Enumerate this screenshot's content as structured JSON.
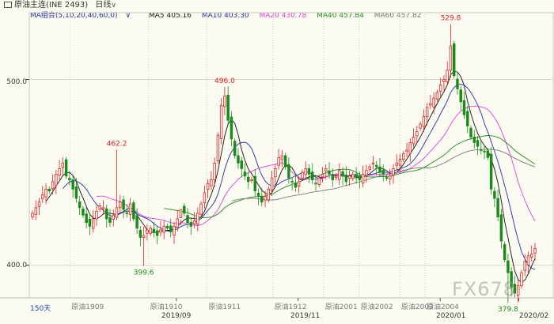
{
  "header": {
    "title": "原油主连(INE 2493)",
    "period_label": "日线"
  },
  "ma_legend": {
    "group_label": "MA组合(5,10,20,40,60,0)",
    "items": [
      {
        "label": "MA5 405.16",
        "color": "#111111"
      },
      {
        "label": "MA10 403.30",
        "color": "#1f2fa8"
      },
      {
        "label": "MA20 430.78",
        "color": "#e040e0"
      },
      {
        "label": "MA40 457.84",
        "color": "#1e8a1e"
      },
      {
        "label": "MA60 457.82",
        "color": "#777777"
      }
    ]
  },
  "axis": {
    "y_ticks": [
      "500.0",
      "400.0"
    ],
    "bar_count_label": "150天",
    "x_months": [
      "2019/09",
      "2019/11",
      "2020/01",
      "2020/02"
    ],
    "contract_markers": [
      "原油1909",
      "原油1910",
      "原油1911",
      "原油1912",
      "原油2001",
      "原油2002",
      "原油2003",
      "原油2004"
    ]
  },
  "annotations": {
    "max_label": "529.8",
    "min_label": "379.8",
    "local_high_1": "462.2",
    "local_low_1": "399.6",
    "local_high_2": "496.0"
  },
  "watermark": "FX678",
  "chart_data": {
    "type": "candlestick",
    "title": "原油主连(INE 2493)",
    "ylim": [
      382,
      530
    ],
    "y_ticks": [
      400,
      500
    ],
    "x_labels": [
      "2019/09",
      "2019/11",
      "2020/01",
      "2020/02"
    ],
    "colors": {
      "up": "#e02020",
      "down": "#1a8a1a"
    },
    "closes": [
      428,
      431,
      434,
      438,
      441,
      440,
      445,
      449,
      452,
      455,
      448,
      446,
      441,
      436,
      431,
      427,
      423,
      421,
      425,
      429,
      432,
      431,
      425,
      423,
      427,
      431,
      434,
      430,
      428,
      433,
      425,
      420,
      415,
      416,
      419,
      420,
      418,
      416,
      419,
      421,
      420,
      418,
      421,
      425,
      430,
      428,
      423,
      421,
      424,
      428,
      433,
      439,
      444,
      446,
      455,
      470,
      486,
      491,
      478,
      468,
      459,
      455,
      452,
      448,
      445,
      446,
      440,
      437,
      434,
      437,
      441,
      447,
      452,
      458,
      459,
      453,
      447,
      445,
      442,
      445,
      450,
      452,
      449,
      446,
      444,
      447,
      449,
      452,
      449,
      446,
      448,
      451,
      448,
      445,
      448,
      449,
      447,
      446,
      449,
      451,
      453,
      455,
      453,
      450,
      449,
      447,
      448,
      452,
      455,
      457,
      460,
      462,
      466,
      469,
      472,
      476,
      480,
      485,
      487,
      490,
      493,
      497,
      500,
      505,
      518,
      502,
      495,
      488,
      481,
      475,
      469,
      466,
      464,
      462,
      461,
      458,
      441,
      436,
      426,
      413,
      403,
      396,
      388,
      385,
      389,
      396,
      402,
      405,
      406,
      409
    ],
    "highs": {
      "25": 462.2,
      "44": 424.5,
      "57": 496.0,
      "124": 529.8
    },
    "lows": {
      "33": 399.6,
      "141": 379.8
    },
    "series": [
      {
        "name": "MA5",
        "color": "#111111"
      },
      {
        "name": "MA10",
        "color": "#1f2fa8"
      },
      {
        "name": "MA20",
        "color": "#e040e0"
      },
      {
        "name": "MA40",
        "color": "#1e8a1e"
      },
      {
        "name": "MA60",
        "color": "#777777"
      }
    ],
    "period_markers": [
      {
        "label": "原油1909",
        "index": 16
      },
      {
        "label": "原油1910",
        "index": 47
      },
      {
        "label": "原油1911",
        "index": 70
      },
      {
        "label": "原油1912",
        "index": 96
      },
      {
        "label": "原油2001",
        "index": 116
      },
      {
        "label": "原油2002",
        "index": 130
      },
      {
        "label": "原油2003",
        "index": 146
      },
      {
        "label": "原油2004",
        "index": 156
      }
    ],
    "month_ticks": [
      {
        "label": "2019/09",
        "index": 58
      },
      {
        "label": "2019/11",
        "index": 106
      },
      {
        "label": "2020/01",
        "index": 162
      },
      {
        "label": "2020/02",
        "index": 193
      }
    ]
  }
}
